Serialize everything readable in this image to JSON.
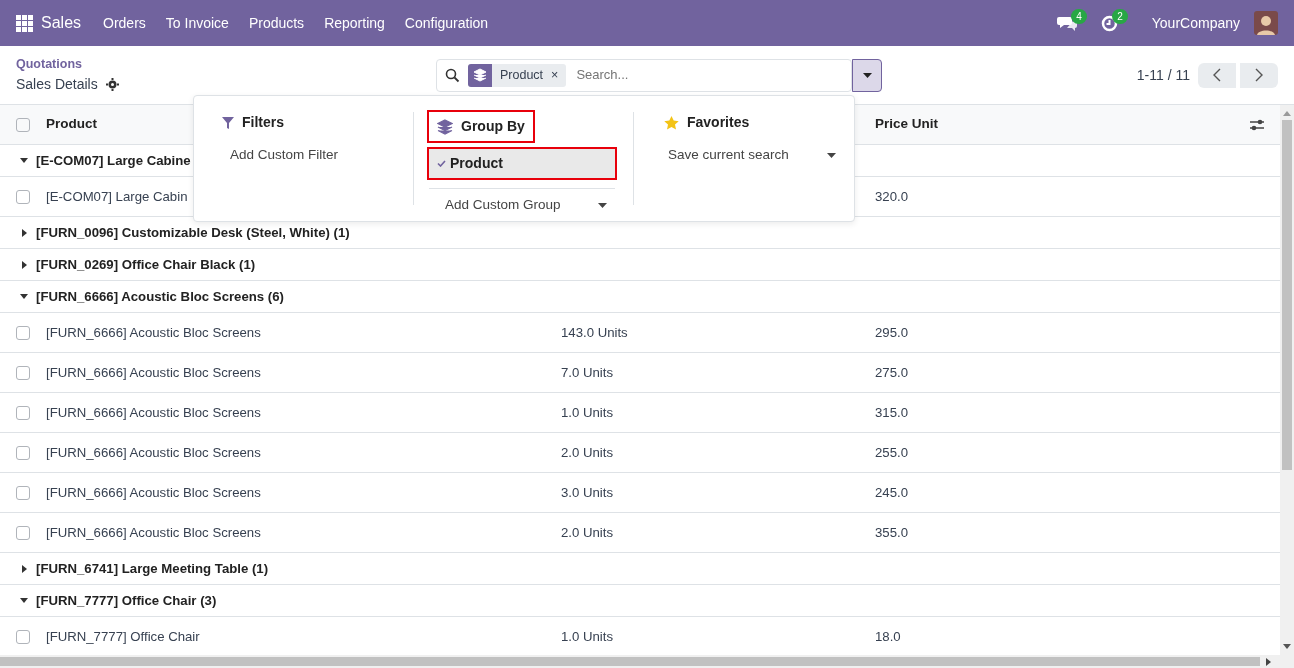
{
  "navbar": {
    "app": "Sales",
    "menu": [
      "Orders",
      "To Invoice",
      "Products",
      "Reporting",
      "Configuration"
    ],
    "messages_count": "4",
    "activities_count": "2",
    "company": "YourCompany"
  },
  "control_panel": {
    "breadcrumb": "Quotations",
    "title": "Sales Details",
    "search": {
      "facet": "Product",
      "facet_remove": "×",
      "placeholder": "Search..."
    },
    "pager": "1-11 / 11"
  },
  "search_panel": {
    "filters": {
      "title": "Filters",
      "items": [
        "Add Custom Filter"
      ]
    },
    "group_by": {
      "title": "Group By",
      "highlighted": true,
      "options": [
        {
          "label": "Product",
          "selected": true,
          "highlighted": true
        }
      ],
      "add_custom": "Add Custom Group"
    },
    "favorites": {
      "title": "Favorites",
      "items": [
        "Save current search"
      ]
    }
  },
  "table": {
    "select_all_checked": false,
    "column_headers": [
      "Product",
      "Price Unit"
    ],
    "rows": [
      {
        "kind": "group",
        "label": "[E-COM07] Large Cabine",
        "expanded": true
      },
      {
        "kind": "line",
        "product": "[E-COM07] Large Cabin",
        "price": "320.0",
        "checked": false
      },
      {
        "kind": "group",
        "label": "[FURN_0096] Customizable Desk (Steel, White) (1)",
        "expanded": false
      },
      {
        "kind": "group",
        "label": "[FURN_0269] Office Chair Black (1)",
        "expanded": false
      },
      {
        "kind": "group",
        "label": "[FURN_6666] Acoustic Bloc Screens (6)",
        "expanded": true
      },
      {
        "kind": "line",
        "product": "[FURN_6666] Acoustic Bloc Screens",
        "quantity": "143.0 Units",
        "price": "295.0",
        "checked": false
      },
      {
        "kind": "line",
        "product": "[FURN_6666] Acoustic Bloc Screens",
        "quantity": "7.0 Units",
        "price": "275.0",
        "checked": false
      },
      {
        "kind": "line",
        "product": "[FURN_6666] Acoustic Bloc Screens",
        "quantity": "1.0 Units",
        "price": "315.0",
        "checked": false
      },
      {
        "kind": "line",
        "product": "[FURN_6666] Acoustic Bloc Screens",
        "quantity": "2.0 Units",
        "price": "255.0",
        "checked": false
      },
      {
        "kind": "line",
        "product": "[FURN_6666] Acoustic Bloc Screens",
        "quantity": "3.0 Units",
        "price": "245.0",
        "checked": false
      },
      {
        "kind": "line",
        "product": "[FURN_6666] Acoustic Bloc Screens",
        "quantity": "2.0 Units",
        "price": "355.0",
        "checked": false
      },
      {
        "kind": "group",
        "label": "[FURN_6741] Large Meeting Table (1)",
        "expanded": false
      },
      {
        "kind": "group",
        "label": "[FURN_7777] Office Chair (3)",
        "expanded": true
      },
      {
        "kind": "line",
        "product": "[FURN_7777] Office Chair",
        "quantity": "1.0 Units",
        "price": "18.0",
        "checked": false
      }
    ]
  }
}
